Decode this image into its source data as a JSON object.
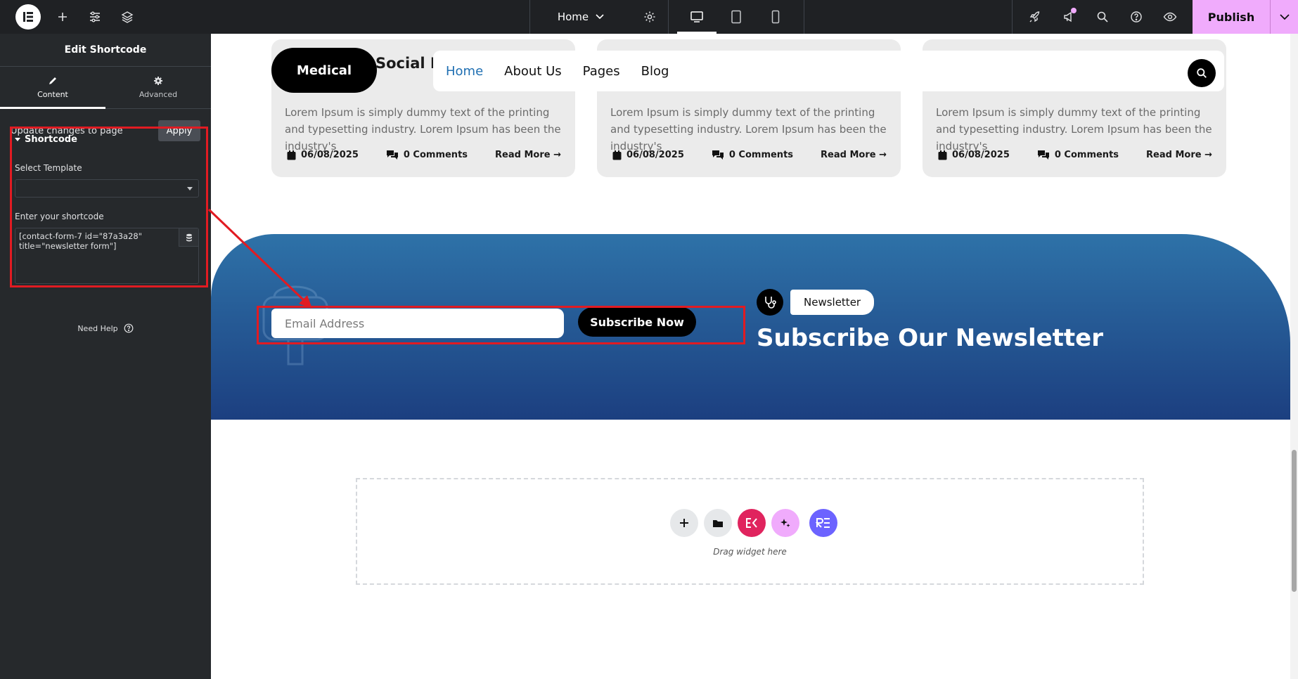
{
  "topbar": {
    "page_name": "Home",
    "publish_label": "Publish"
  },
  "panel": {
    "title": "Edit Shortcode",
    "tabs": [
      {
        "label": "Content"
      },
      {
        "label": "Advanced"
      }
    ],
    "update_text": "Update changes to page",
    "apply_label": "Apply",
    "section_title": "Shortcode",
    "select_template_label": "Select Template",
    "select_template_value": "",
    "shortcode_label": "Enter your shortcode",
    "shortcode_value": "[contact-form-7 id=\"87a3a28\" title=\"newsletter form\"]",
    "need_help": "Need Help"
  },
  "canvas": {
    "logo_label": "Medical",
    "card_title": "Social Media",
    "nav": [
      "Home",
      "About Us",
      "Pages",
      "Blog"
    ],
    "cards": [
      {
        "text": "Lorem Ipsum is simply dummy text of the printing and typesetting industry. Lorem Ipsum has been the industry's",
        "date": "06/08/2025",
        "comments": "0 Comments",
        "read_more": "Read More →"
      },
      {
        "text": "Lorem Ipsum is simply dummy text of the printing and typesetting industry. Lorem Ipsum has been the industry's",
        "date": "06/08/2025",
        "comments": "0 Comments",
        "read_more": "Read More →"
      },
      {
        "text": "Lorem Ipsum is simply dummy text of the printing and typesetting industry. Lorem Ipsum has been the industry's",
        "date": "06/08/2025",
        "comments": "0 Comments",
        "read_more": "Read More →"
      }
    ],
    "newsletter": {
      "email_placeholder": "Email Address",
      "subscribe_label": "Subscribe Now",
      "badge_label": "Newsletter",
      "title": "Subscribe Our Newsletter"
    },
    "drop_zone_text": "Drag widget here"
  },
  "colors": {
    "editor_dark": "#1f2124",
    "panel": "#26292c",
    "publish": "#f0abfc",
    "highlight": "#e11b22",
    "newsletter_top": "#2e72a8",
    "newsletter_bottom": "#1c3f80"
  }
}
